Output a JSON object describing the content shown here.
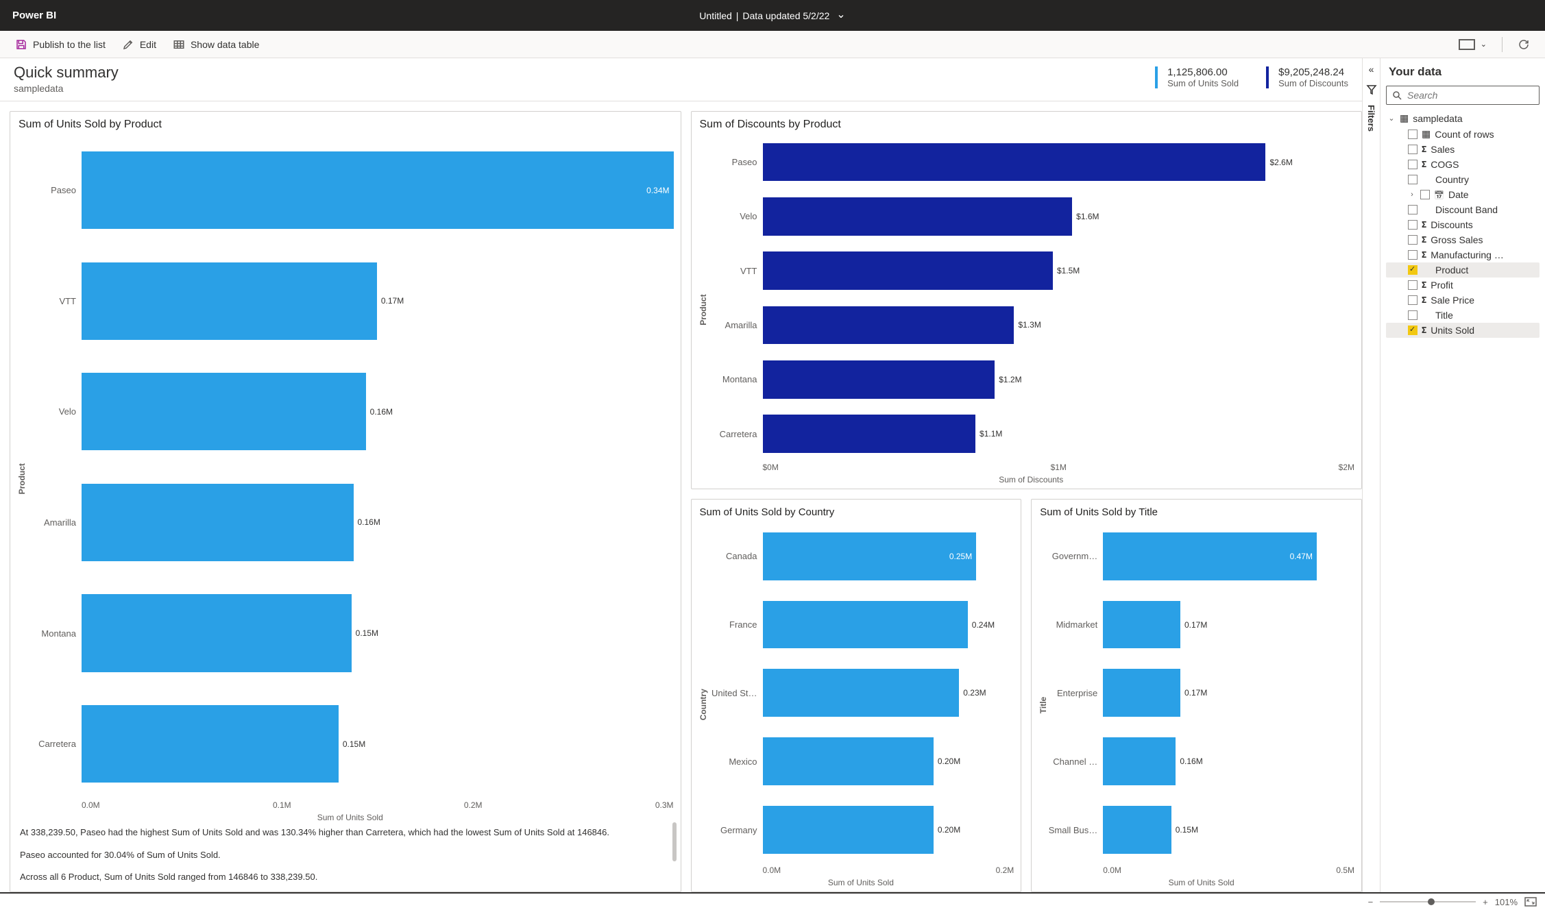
{
  "header": {
    "brand": "Power BI",
    "doc_title": "Untitled",
    "updated": "Data updated 5/2/22"
  },
  "toolbar": {
    "publish": "Publish to the list",
    "edit": "Edit",
    "data_table": "Show data table"
  },
  "summary": {
    "title": "Quick summary",
    "subtitle": "sampledata",
    "kpis": [
      {
        "value": "1,125,806.00",
        "label": "Sum of Units Sold"
      },
      {
        "value": "$9,205,248.24",
        "label": "Sum of Discounts"
      }
    ]
  },
  "chart_data": [
    {
      "id": "units_by_product",
      "title": "Sum of Units Sold by Product",
      "type": "bar",
      "orientation": "horizontal",
      "xlabel": "Sum of Units Sold",
      "ylabel": "Product",
      "color": "#2aa0e6",
      "x_ticks": [
        "0.0M",
        "0.1M",
        "0.2M",
        "0.3M"
      ],
      "categories": [
        "Paseo",
        "VTT",
        "Velo",
        "Amarilla",
        "Montana",
        "Carretera"
      ],
      "values": [
        338239.5,
        168783,
        162424,
        155315,
        154198,
        146846
      ],
      "value_labels": [
        "0.34M",
        "0.17M",
        "0.16M",
        "0.16M",
        "0.15M",
        "0.15M"
      ],
      "max": 338239.5,
      "insights": [
        "At 338,239.50, Paseo had the highest Sum of Units Sold and was 130.34% higher than Carretera, which had the lowest Sum of Units Sold at 146846.",
        "Paseo accounted for 30.04% of Sum of Units Sold.",
        "Across all 6 Product, Sum of Units Sold ranged from 146846 to 338,239.50."
      ]
    },
    {
      "id": "discounts_by_product",
      "title": "Sum of Discounts by Product",
      "type": "bar",
      "orientation": "horizontal",
      "xlabel": "Sum of Discounts",
      "ylabel": "Product",
      "color": "#12239e",
      "x_ticks": [
        "$0M",
        "$1M",
        "$2M"
      ],
      "categories": [
        "Paseo",
        "Velo",
        "VTT",
        "Amarilla",
        "Montana",
        "Carretera"
      ],
      "values": [
        2600000,
        1600000,
        1500000,
        1300000,
        1200000,
        1100000
      ],
      "value_labels": [
        "$2.6M",
        "$1.6M",
        "$1.5M",
        "$1.3M",
        "$1.2M",
        "$1.1M"
      ],
      "max": 2600000
    },
    {
      "id": "units_by_country",
      "title": "Sum of Units Sold by Country",
      "type": "bar",
      "orientation": "horizontal",
      "xlabel": "Sum of Units Sold",
      "ylabel": "Country",
      "color": "#2aa0e6",
      "x_ticks": [
        "0.0M",
        "0.2M"
      ],
      "categories": [
        "Canada",
        "France",
        "United St…",
        "Mexico",
        "Germany"
      ],
      "values": [
        250000,
        240000,
        230000,
        200000,
        200000
      ],
      "value_labels": [
        "0.25M",
        "0.24M",
        "0.23M",
        "0.20M",
        "0.20M"
      ],
      "max": 250000
    },
    {
      "id": "units_by_title",
      "title": "Sum of Units Sold by Title",
      "type": "bar",
      "orientation": "horizontal",
      "xlabel": "Sum of Units Sold",
      "ylabel": "Title",
      "color": "#2aa0e6",
      "x_ticks": [
        "0.0M",
        "0.5M"
      ],
      "categories": [
        "Governm…",
        "Midmarket",
        "Enterprise",
        "Channel …",
        "Small Bus…"
      ],
      "values": [
        470000,
        170000,
        170000,
        160000,
        150000
      ],
      "value_labels": [
        "0.47M",
        "0.17M",
        "0.17M",
        "0.16M",
        "0.15M"
      ],
      "max": 470000
    }
  ],
  "rail": {
    "filters": "Filters"
  },
  "sidebar": {
    "title": "Your data",
    "search_placeholder": "Search",
    "dataset": "sampledata",
    "fields": [
      {
        "label": "Count of rows",
        "icon": "table",
        "checked": false
      },
      {
        "label": "Sales",
        "icon": "sigma",
        "checked": false
      },
      {
        "label": "COGS",
        "icon": "sigma",
        "checked": false
      },
      {
        "label": "Country",
        "icon": "",
        "checked": false
      },
      {
        "label": "Date",
        "icon": "calendar",
        "checked": false,
        "expandable": true
      },
      {
        "label": "Discount Band",
        "icon": "",
        "checked": false
      },
      {
        "label": "Discounts",
        "icon": "sigma",
        "checked": false
      },
      {
        "label": "Gross Sales",
        "icon": "sigma",
        "checked": false
      },
      {
        "label": "Manufacturing …",
        "icon": "sigma",
        "checked": false
      },
      {
        "label": "Product",
        "icon": "",
        "checked": true
      },
      {
        "label": "Profit",
        "icon": "sigma",
        "checked": false
      },
      {
        "label": "Sale Price",
        "icon": "sigma",
        "checked": false
      },
      {
        "label": "Title",
        "icon": "",
        "checked": false
      },
      {
        "label": "Units Sold",
        "icon": "sigma",
        "checked": true
      }
    ]
  },
  "status": {
    "zoom": "101%"
  }
}
